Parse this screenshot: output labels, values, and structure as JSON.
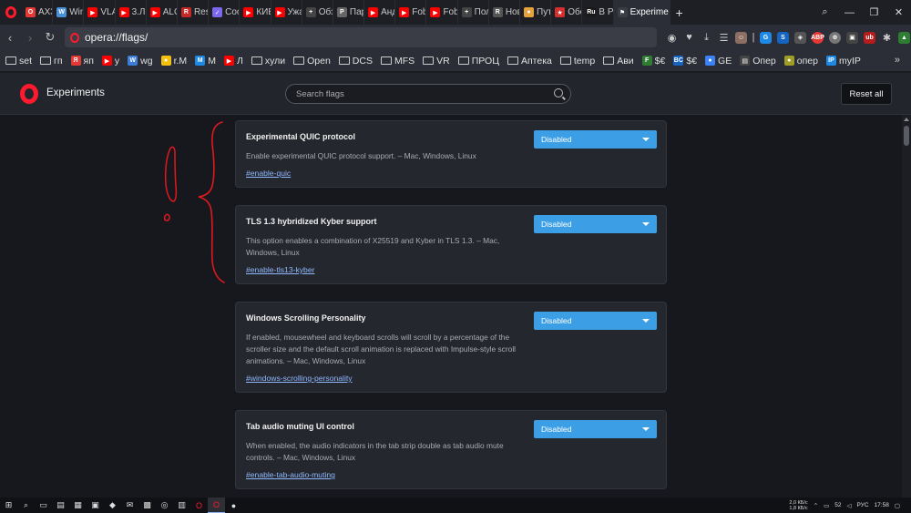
{
  "tabs": [
    {
      "label": "АХЗС",
      "color": "#e53935",
      "glyph": "O"
    },
    {
      "label": "Windows",
      "color": "#4a90d9",
      "glyph": "W"
    },
    {
      "label": "VLAD",
      "color": "#ff0000",
      "glyph": "▶"
    },
    {
      "label": "3.Л.С",
      "color": "#ff0000",
      "glyph": "▶"
    },
    {
      "label": "ALOH",
      "color": "#ff0000",
      "glyph": "▶"
    },
    {
      "label": "Resident",
      "color": "#c62828",
      "glyph": "R"
    },
    {
      "label": "Cool",
      "color": "#7b68ee",
      "glyph": "✓"
    },
    {
      "label": "КИБЕР",
      "color": "#ff0000",
      "glyph": "▶"
    },
    {
      "label": "Ужас",
      "color": "#ff0000",
      "glyph": "▶"
    },
    {
      "label": "Обзор",
      "color": "#444",
      "glyph": "+"
    },
    {
      "label": "Пара",
      "color": "#666",
      "glyph": "P"
    },
    {
      "label": "Андр",
      "color": "#ff0000",
      "glyph": "▶"
    },
    {
      "label": "Fobi",
      "color": "#ff0000",
      "glyph": "▶"
    },
    {
      "label": "Fobi",
      "color": "#ff0000",
      "glyph": "▶"
    },
    {
      "label": "Поле",
      "color": "#444",
      "glyph": "+"
    },
    {
      "label": "Нові",
      "color": "#555",
      "glyph": "R"
    },
    {
      "label": "Путе",
      "color": "#e6a23c",
      "glyph": "●"
    },
    {
      "label": "Обсу",
      "color": "#d32f2f",
      "glyph": "★"
    },
    {
      "label": "В Ро",
      "color": "#1a1a1a",
      "glyph": "Ru"
    }
  ],
  "active_tab": {
    "label": "Experime",
    "glyph": "⚑"
  },
  "address": {
    "url": "opera://flags/"
  },
  "bookmarks": [
    {
      "label": "set",
      "kind": "folder"
    },
    {
      "label": "гп",
      "kind": "folder"
    },
    {
      "label": "яп",
      "kind": "fav",
      "color": "#e53935",
      "glyph": "Я"
    },
    {
      "label": "у",
      "kind": "fav",
      "color": "#ff0000",
      "glyph": "▶"
    },
    {
      "label": "wg",
      "kind": "fav",
      "color": "#3b7dd8",
      "glyph": "W"
    },
    {
      "label": "r.M",
      "kind": "fav",
      "color": "#f4c20d",
      "glyph": "●"
    },
    {
      "label": "M",
      "kind": "fav",
      "color": "#1e88e5",
      "glyph": "M"
    },
    {
      "label": "Л",
      "kind": "fav",
      "color": "#ff0000",
      "glyph": "▶"
    },
    {
      "label": "хули",
      "kind": "folder"
    },
    {
      "label": "Open",
      "kind": "folder"
    },
    {
      "label": "DCS",
      "kind": "folder"
    },
    {
      "label": "MFS",
      "kind": "folder"
    },
    {
      "label": "VR",
      "kind": "folder"
    },
    {
      "label": "ПРОЦ",
      "kind": "folder"
    },
    {
      "label": "Аптека",
      "kind": "folder"
    },
    {
      "label": "temp",
      "kind": "folder"
    },
    {
      "label": "Ави",
      "kind": "folder"
    },
    {
      "label": "$€",
      "kind": "fav",
      "color": "#2e7d32",
      "glyph": "F"
    },
    {
      "label": "$€",
      "kind": "fav",
      "color": "#1565c0",
      "glyph": "BC"
    },
    {
      "label": "GE",
      "kind": "fav",
      "color": "#3b82f6",
      "glyph": "●"
    },
    {
      "label": "Опер",
      "kind": "fav",
      "color": "#444",
      "glyph": "▤"
    },
    {
      "label": "опер",
      "kind": "fav",
      "color": "#9e9d24",
      "glyph": "●"
    },
    {
      "label": "myIP",
      "kind": "fav",
      "color": "#1e88e5",
      "glyph": "IP"
    }
  ],
  "page": {
    "title": "Experiments",
    "search_placeholder": "Search flags",
    "reset_label": "Reset all"
  },
  "flags": [
    {
      "title": "Experimental QUIC protocol",
      "description": "Enable experimental QUIC protocol support. – Mac, Windows, Linux",
      "link": "#enable-quic",
      "value": "Disabled"
    },
    {
      "title": "TLS 1.3 hybridized Kyber support",
      "description": "This option enables a combination of X25519 and Kyber in TLS 1.3. – Mac, Windows, Linux",
      "link": "#enable-tls13-kyber",
      "value": "Disabled"
    },
    {
      "title": "Windows Scrolling Personality",
      "description": "If enabled, mousewheel and keyboard scrolls will scroll by a percentage of the scroller size and the default scroll animation is replaced with Impulse-style scroll animations. – Mac, Windows, Linux",
      "link": "#windows-scrolling-personality",
      "value": "Disabled"
    },
    {
      "title": "Tab audio muting UI control",
      "description": "When enabled, the audio indicators in the tab strip double as tab audio mute controls. – Mac, Windows, Linux",
      "link": "#enable-tab-audio-muting",
      "value": "Disabled"
    }
  ],
  "annotation_color": "#e0191e",
  "tray": {
    "net_up": "2,0 КБ/с",
    "net_down": "1,8 КБ/с",
    "volume": "52",
    "lang": "РУС",
    "time": "17:58"
  }
}
